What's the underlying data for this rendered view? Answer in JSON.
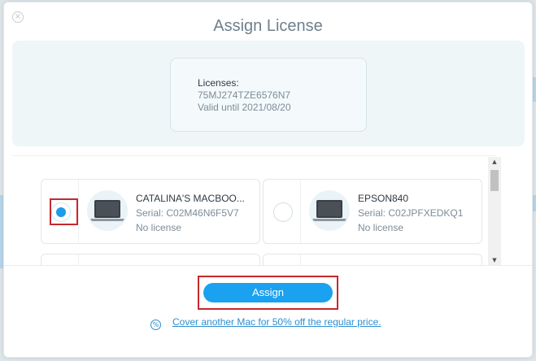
{
  "window": {
    "title": "Assign License",
    "close_icon": "×"
  },
  "license": {
    "label": "Licenses:",
    "key": "75MJ274TZE6576N7",
    "valid": "Valid until 2021/08/20"
  },
  "devices": [
    {
      "name": "CATALINA'S MACBOO...",
      "serial": "Serial: C02M46N6F5V7",
      "status": "No license",
      "selected": true
    },
    {
      "name": "EPSON840",
      "serial": "Serial: C02JPFXEDKQ1",
      "status": "No license",
      "selected": false
    }
  ],
  "footer": {
    "assign_label": "Assign",
    "promo_icon": "%",
    "promo_text": "Cover another Mac for 50% off the regular price."
  },
  "colors": {
    "accent": "#1aa1ef",
    "highlight": "#c6282d",
    "title": "#6f7f8c"
  }
}
